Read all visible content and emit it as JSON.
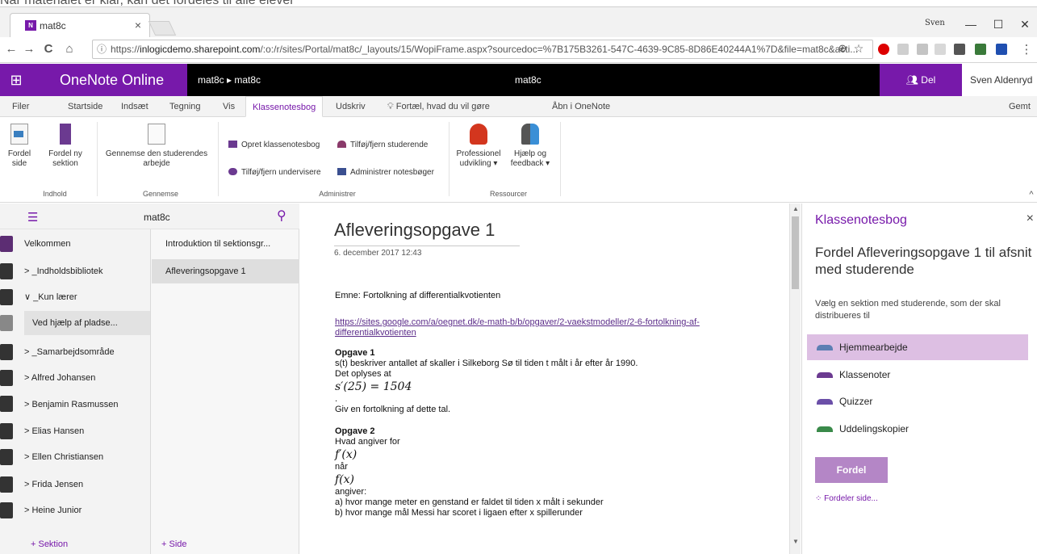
{
  "caption": "Når materialet er klar, kan det fordeles til alle elever",
  "browser": {
    "tab_title": "mat8c",
    "tab_close": "×",
    "user_chip": "Sven",
    "minimize": "—",
    "maximize": "☐",
    "close": "✕",
    "back": "←",
    "forward": "→",
    "reload": "C",
    "home": "⌂",
    "url_prefix": "https://",
    "url_host": "inlogicdemo.sharepoint.com",
    "url_rest": "/:o:/r/sites/Portal/mat8c/_layouts/15/WopiFrame.aspx?sourcedoc=%7B175B3261-547C-4639-9C85-8D86E40244A1%7D&file=mat8c&acti...",
    "info_icon": "ⓘ",
    "zoom_icon": "⊕",
    "star_icon": "☆",
    "menu_icon": "⋮"
  },
  "app": {
    "waffle": "⊞",
    "brand": "OneNote Online",
    "breadcrumb": "mat8c ▸ mat8c",
    "center_title": "mat8c",
    "share_label": "Del",
    "user_name": "Sven Aldenryd"
  },
  "ribbon_tabs": [
    "Filer",
    "Startside",
    "Indsæt",
    "Tegning",
    "Vis",
    "Klassenotesbog",
    "Udskriv",
    "Fortæl, hvad du vil gøre",
    "Åbn i OneNote",
    "Gemt"
  ],
  "ribbon": {
    "distribute_page": "Fordel\nside",
    "distribute_section": "Fordel ny\nsektion",
    "review_work": "Gennemse den studerendes\narbejde",
    "create_notebook": "Opret klassenotesbog",
    "add_remove_students": "Tilføj/fjern studerende",
    "add_remove_teachers": "Tilføj/fjern undervisere",
    "manage_notebooks": "Administrer notesbøger",
    "professional": "Professionel\nudvikling ▾",
    "help_feedback": "Hjælp og\nfeedback ▾",
    "group_content": "Indhold",
    "group_review": "Gennemse",
    "group_admin": "Administrer",
    "group_resources": "Ressourcer",
    "collapse": "^"
  },
  "navpane": {
    "notebook_name": "mat8c",
    "hamburger": "☰",
    "search_icon": "⚲",
    "sections": [
      "Velkommen",
      "> _Indholdsbibliotek",
      "∨ _Kun lærer",
      "Ved hjælp af pladse...",
      "> _Samarbejdsområde",
      "> Alfred Johansen",
      "> Benjamin Rasmussen",
      "> Elias Hansen",
      "> Ellen Christiansen",
      "> Frida Jensen",
      "> Heine Junior"
    ],
    "pages": [
      "Introduktion til sektionsgr...",
      "Afleveringsopgave 1"
    ],
    "add_section": "+ Sektion",
    "add_page": "+ Side"
  },
  "page": {
    "title": "Afleveringsopgave 1",
    "date": "6. december 2017   12:43",
    "topic": "Emne: Fortolkning af differentialkvotienten",
    "link": "https://sites.google.com/a/oegnet.dk/e-math-b/b/opgaver/2-vaekstmodeller/2-6-fortolkning-af-differentialkvotienten",
    "task1_heading": "Opgave 1",
    "task1_line1": "s(t) beskriver antallet af skaller i Silkeborg Sø til tiden t målt i år efter år 1990.",
    "task1_line2": "Det oplyses at",
    "task1_math": "s′(25) = 1504",
    "task1_dot": ".",
    "task1_line3": "Giv en fortolkning af dette tal.",
    "task2_heading": "Opgave 2",
    "task2_line1": "Hvad angiver for",
    "task2_math1": "f′(x)",
    "task2_line2": " når",
    "task2_math2": "f(x)",
    "task2_line3": " angiver:",
    "task2_a": "a) hvor mange meter en genstand er faldet til tiden x målt i sekunder",
    "task2_b": "b) hvor mange mål Messi har scoret i ligaen efter x spillerunder"
  },
  "panel": {
    "title": "Klassenotesbog",
    "close": "×",
    "heading": "Fordel Afleveringsopgave 1 til afsnit med studerende",
    "description": "Vælg en sektion med studerende, som der skal distribueres til",
    "options": [
      {
        "label": "Hjemmearbejde",
        "color": "#5c7fb3"
      },
      {
        "label": "Klassenoter",
        "color": "#6b3a90"
      },
      {
        "label": "Quizzer",
        "color": "#6b4fa8"
      },
      {
        "label": "Uddelingskopier",
        "color": "#3a8a4a"
      }
    ],
    "button": "Fordel",
    "status": "Fordeler side..."
  },
  "colors": {
    "accent": "#7719aa",
    "selected_option": "#ddbfe3"
  }
}
